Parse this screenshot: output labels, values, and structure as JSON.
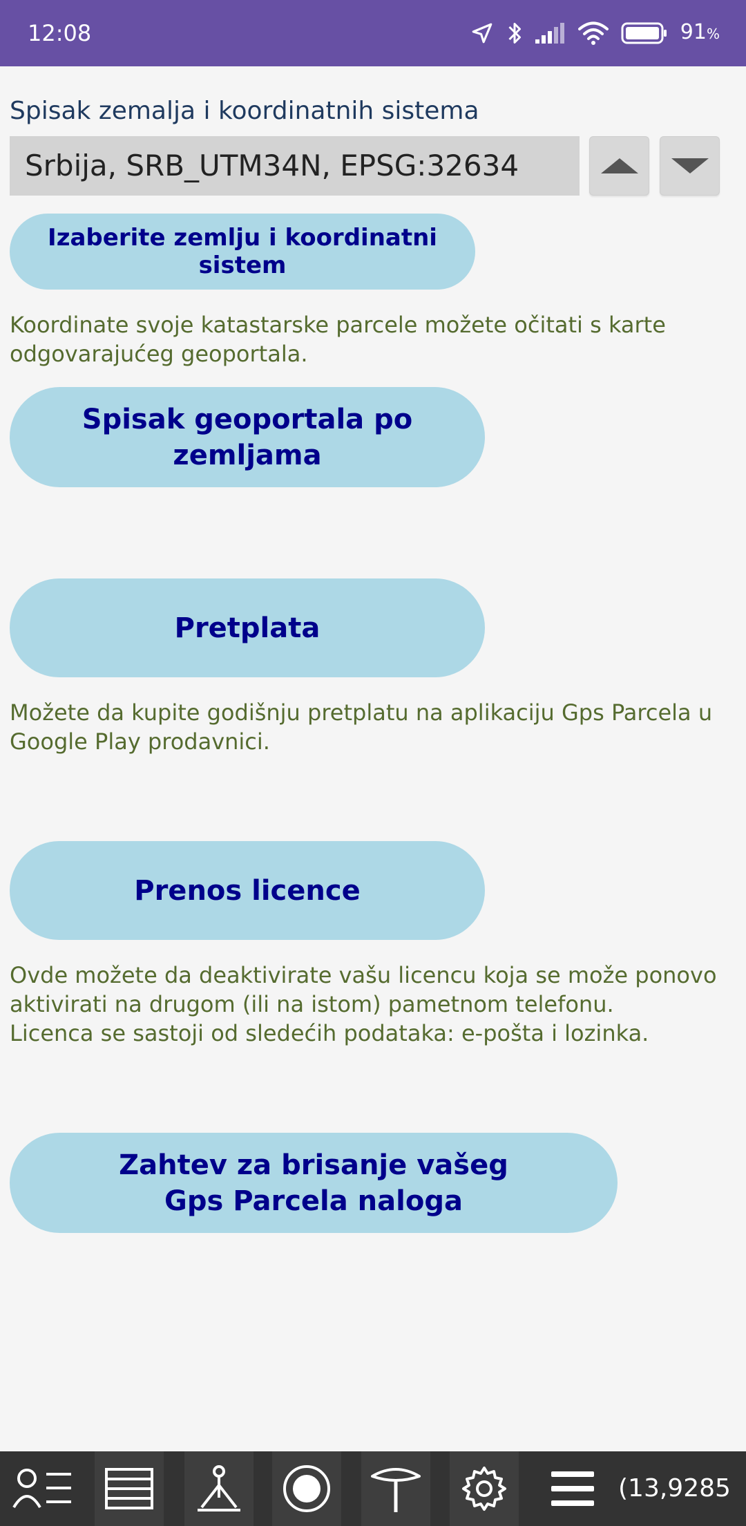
{
  "status_bar": {
    "time": "12:08",
    "battery_value": "91",
    "battery_unit": "%",
    "icons": [
      "location-arrow-icon",
      "bluetooth-icon",
      "signal-icon",
      "wifi-icon",
      "battery-icon"
    ]
  },
  "coordinate_system": {
    "label": "Spisak zemalja i koordinatnih sistema",
    "selected": "Srbija, SRB_UTM34N, EPSG:32634",
    "choose_button": "Izaberite zemlju i koordinatni sistem"
  },
  "geoportal": {
    "info": "Koordinate svoje katastarske parcele možete očitati s karte odgovarajućeg geoportala.",
    "button": "Spisak geoportala po zemljama"
  },
  "subscription": {
    "button": "Pretplata",
    "info": "Možete da kupite godišnju pretplatu na aplikaciju Gps Parcela u Google Play prodavnici."
  },
  "license": {
    "button": "Prenos licence",
    "info": "Ovde možete da deaktivirate vašu licencu koja se može ponovo aktivirati na drugom (ili na istom) pametnom telefonu.\nLicenca se sastoji od sledećih podataka: e-pošta i lozinka."
  },
  "account": {
    "button": "Zahtev za brisanje vašeg Gps Parcela naloga"
  },
  "bottom_nav": {
    "items": [
      "user-list-icon",
      "layers-icon",
      "survey-tripod-icon",
      "record-circle-icon",
      "gps-antenna-icon",
      "gear-icon",
      "menu-icon"
    ],
    "coordinate_readout": "(13,9285"
  },
  "colors": {
    "status_bar": "#6750a4",
    "button_bg": "#add8e6",
    "button_text": "#00008b",
    "info_text": "#556b2f",
    "bottom_bar": "#333333"
  }
}
